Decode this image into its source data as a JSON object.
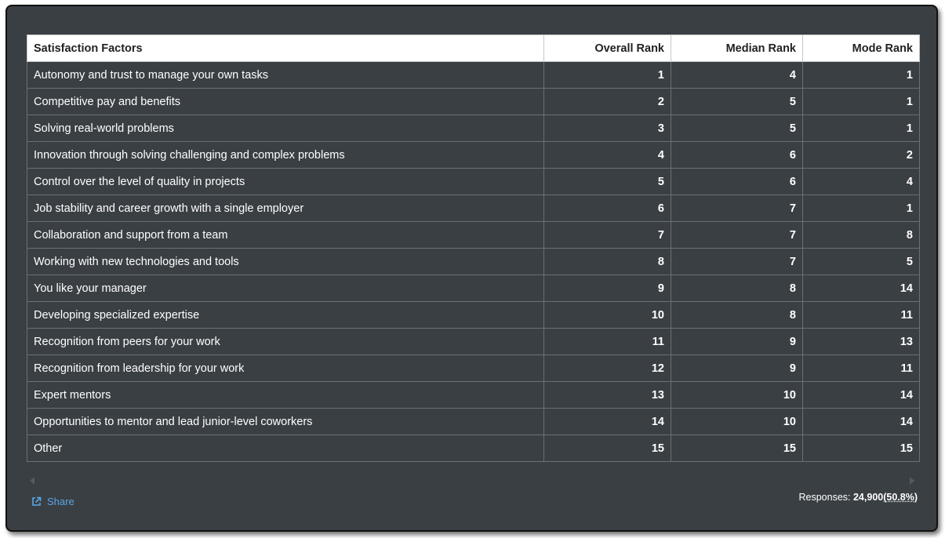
{
  "table": {
    "headers": [
      "Satisfaction Factors",
      "Overall Rank",
      "Median Rank",
      "Mode Rank"
    ],
    "rows": [
      [
        "Autonomy and trust to manage your own tasks",
        "1",
        "4",
        "1"
      ],
      [
        "Competitive pay and benefits",
        "2",
        "5",
        "1"
      ],
      [
        "Solving real-world problems",
        "3",
        "5",
        "1"
      ],
      [
        "Innovation through solving challenging and complex problems",
        "4",
        "6",
        "2"
      ],
      [
        "Control over the level of quality in projects",
        "5",
        "6",
        "4"
      ],
      [
        "Job stability and career growth with a single employer",
        "6",
        "7",
        "1"
      ],
      [
        "Collaboration and support from a team",
        "7",
        "7",
        "8"
      ],
      [
        "Working with new technologies and tools",
        "8",
        "7",
        "5"
      ],
      [
        "You like your manager",
        "9",
        "8",
        "14"
      ],
      [
        "Developing specialized expertise",
        "10",
        "8",
        "11"
      ],
      [
        "Recognition from peers for your work",
        "11",
        "9",
        "13"
      ],
      [
        "Recognition from leadership for your work",
        "12",
        "9",
        "11"
      ],
      [
        "Expert mentors",
        "13",
        "10",
        "14"
      ],
      [
        "Opportunities to mentor and lead junior-level coworkers",
        "14",
        "10",
        "14"
      ],
      [
        "Other",
        "15",
        "15",
        "15"
      ]
    ]
  },
  "footer": {
    "share_label": "Share",
    "share_icon": "external-link-icon",
    "responses_label": "Responses: ",
    "responses_count": "24,900",
    "responses_pct": "(50.8%)"
  },
  "colors": {
    "background": "#3a3f44",
    "header_bg": "#ffffff",
    "link": "#5aa7e6"
  }
}
